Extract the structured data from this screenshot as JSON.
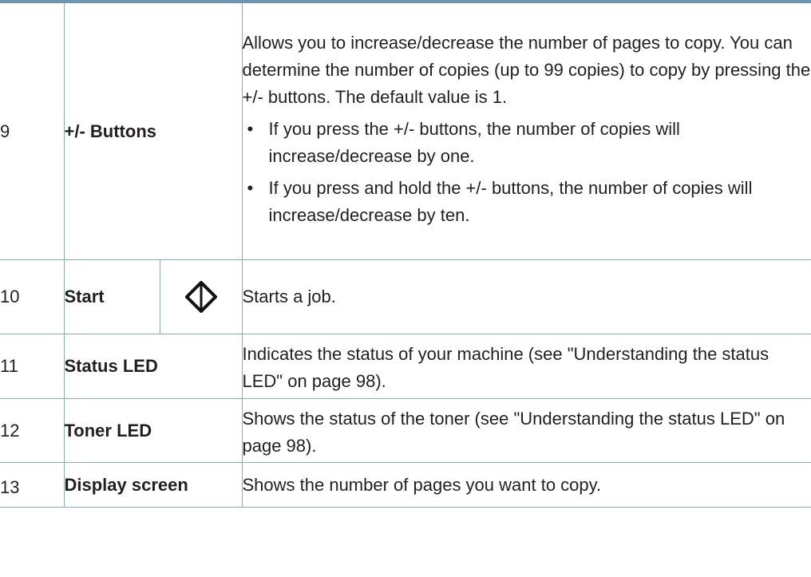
{
  "rows": [
    {
      "number": "9",
      "name": "+/- Buttons",
      "description": "Allows you to increase/decrease the number of pages to copy. You can determine the number of copies (up to 99 copies) to copy by pressing the +/- buttons. The default value is 1.",
      "bullets": [
        "If you press the +/- buttons, the number of copies will increase/decrease by one.",
        "If you press and hold the +/- buttons, the number of copies will increase/decrease by ten."
      ]
    },
    {
      "number": "10",
      "name": "Start",
      "icon": "start-diamond-icon",
      "description": "Starts a job."
    },
    {
      "number": "11",
      "name": "Status LED",
      "description": "Indicates the status of your machine (see \"Understanding the status LED\" on page 98)."
    },
    {
      "number": "12",
      "name": "Toner LED",
      "description": "Shows the status of the toner (see \"Understanding the status LED\" on page 98)."
    },
    {
      "number": "13",
      "name": "Display screen",
      "description": "Shows the number of pages you want to copy."
    }
  ],
  "bullet_glyph": "•",
  "colors": {
    "accent_bar": "#6b95b3",
    "grid_lines": "#8aa9bf",
    "text": "#231f20"
  }
}
